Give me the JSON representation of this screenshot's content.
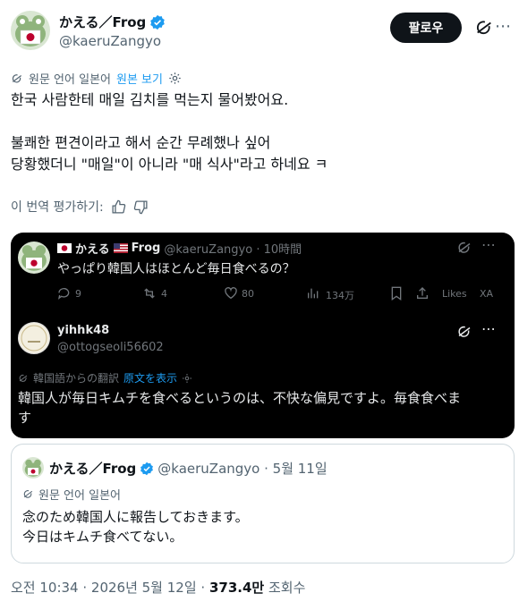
{
  "author": {
    "name": "かえる／Frog",
    "handle": "@kaeruZangyo",
    "follow_label": "팔로우"
  },
  "translation_bar": {
    "label": "원문 언어 일본어",
    "link": "원본 보기"
  },
  "post_lines": [
    "한국 사람한테 매일 김치를 먹는지 물어봤어요.",
    "불쾌한 편견이라고 해서 순간 무례했나 싶어",
    "당황했더니 \"매일\"이 아니라 \"매 식사\"라고 하네요 ㅋ"
  ],
  "rate_translation": "이 번역 평가하기:",
  "screenshot": {
    "orig": {
      "name_a": "かえる",
      "name_b": "Frog",
      "handle_time": "@kaeruZangyo · 10時間",
      "text": "やっぱり韓国人はほとんど毎日食べるの？",
      "replies": "9",
      "reposts": "4",
      "likes": "80",
      "views": "134万",
      "likes_label": "Likes",
      "xa_label": "XA"
    },
    "reply": {
      "name": "yihhk48",
      "handle": "@ottogseoli56602",
      "trans_label": "韓国語からの翻訳",
      "trans_link": "原文を表示",
      "text_line1": "韓国人が毎日キムチを食べるというのは、不快な偏見ですよ。毎食食べま",
      "text_line2": "す"
    }
  },
  "quote": {
    "name": "かえる／Frog",
    "handle_date": "@kaeruZangyo · 5월 11일",
    "translation_label": "원문 언어 일본어",
    "line1": "念のため韓国人に報告しておきます。",
    "line2": "今日はキムチ食べてない。"
  },
  "meta": {
    "time": "오전 10:34 · 2026년 5월 12일 · ",
    "views_value": "373.4만",
    "views_label": " 조회수"
  },
  "colors": {
    "accent": "#1d9bf0",
    "text": "#0f1419",
    "muted": "#536471"
  }
}
